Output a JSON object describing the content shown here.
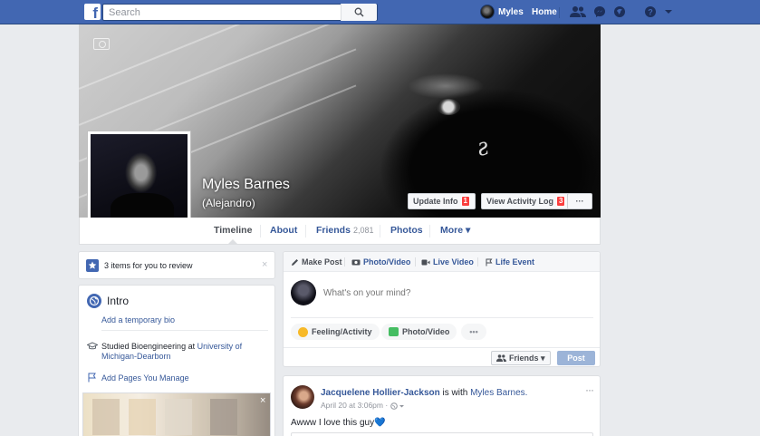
{
  "topbar": {
    "logo": "f",
    "search_placeholder": "Search",
    "user_name": "Myles",
    "home_label": "Home",
    "icons": [
      "friend-requests-icon",
      "messages-icon",
      "notifications-icon",
      "help-icon",
      "account-menu-icon"
    ]
  },
  "profile": {
    "name": "Myles Barnes",
    "alternate_name": "(Alejandro)",
    "update_info_label": "Update Info",
    "update_info_count": "1",
    "activity_log_label": "View Activity Log",
    "activity_log_count": "3",
    "more_label": "···"
  },
  "tabs": [
    {
      "label": "Timeline"
    },
    {
      "label": "About"
    },
    {
      "label": "Friends",
      "count": "2,081"
    },
    {
      "label": "Photos"
    },
    {
      "label": "More ▾"
    }
  ],
  "review": {
    "text": "3 items for you to review",
    "close": "×"
  },
  "intro": {
    "title": "Intro",
    "bio_link": "Add a temporary bio",
    "education_prefix": "Studied Bioengineering at ",
    "education_school": "University of Michigan-Dearborn",
    "pages_link": "Add Pages You Manage",
    "close": "×"
  },
  "composer": {
    "tabs": [
      "Make Post",
      "Photo/Video",
      "Live Video",
      "Life Event"
    ],
    "placeholder": "What's on your mind?",
    "actions": [
      "Feeling/Activity",
      "Photo/Video",
      "•••"
    ],
    "audience_label": "Friends ▾",
    "post_label": "Post"
  },
  "post": {
    "author": "Jacquelene Hollier-Jackson",
    "with_text": " is with ",
    "tagged": "Myles Barnes.",
    "time": "April 20 at 3:06pm · ",
    "text": "Awww I love this guy💙",
    "more": "···"
  },
  "colors": {
    "brand": "#4267b2",
    "link": "#365899",
    "badge": "#fa3e3e",
    "background": "#e9ebee"
  }
}
